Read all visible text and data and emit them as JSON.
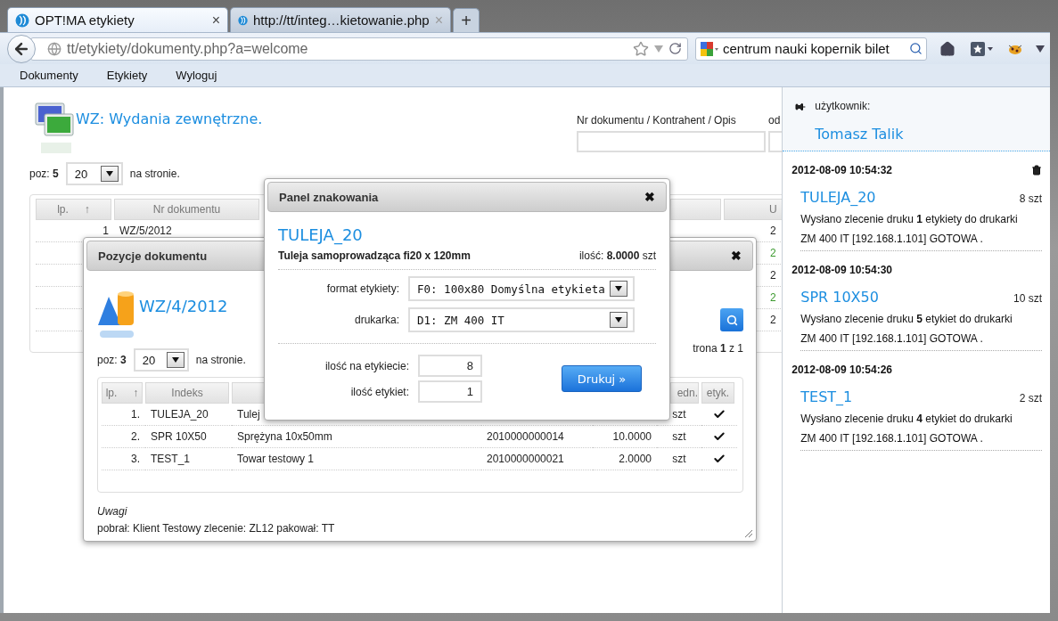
{
  "browser": {
    "tabs": [
      {
        "title": "OPT!MA etykiety",
        "close": "×",
        "selected": true
      },
      {
        "title": "http://tt/integ…kietowanie.php",
        "close": "×",
        "selected": false
      }
    ],
    "new_tab": "+",
    "address": "tt/etykiety/dokumenty.php?a=welcome",
    "search": {
      "value": "centrum nauki kopernik bilet"
    }
  },
  "menu": [
    "Dokumenty",
    "Etykiety",
    "Wyloguj"
  ],
  "page": {
    "title": "WZ: Wydania zewnętrzne.",
    "search_label": "Nr dokumentu / Kontrahent / Opis",
    "from_label": "od",
    "pager": {
      "prefix": "poz:",
      "count": "5",
      "page_size": "20",
      "suffix": "na stronie."
    },
    "table": {
      "header": {
        "lp": "lp.",
        "sort_mark": "↑",
        "number": "Nr dokumentu",
        "column_3": "U"
      },
      "rows": [
        {
          "lp": "1",
          "number": "WZ/5/2012",
          "column_3": "2",
          "color": "#222222"
        },
        {
          "column_3": "2",
          "color": "#3c9a2e"
        },
        {
          "column_3": "2",
          "color": "#222222"
        },
        {
          "column_3": "2",
          "color": "#3c9a2e"
        },
        {
          "column_3": "2",
          "color": "#222222"
        }
      ]
    }
  },
  "sidebar": {
    "user_label": "użytkownik:",
    "user_name": "Tomasz Talik",
    "entries": [
      {
        "time": "2012-08-09 10:54:32",
        "item": "TULEJA_20",
        "qty": "8 szt",
        "message": "Wysłano zlecenie druku **1** etykiety do drukarki ZM 400 IT [192.168.1.101] GOTOWA ."
      },
      {
        "time": "2012-08-09 10:54:30",
        "item": "SPR 10X50",
        "qty": "10 szt",
        "message": "Wysłano zlecenie druku **5** etykiet do drukarki ZM 400 IT [192.168.1.101] GOTOWA ."
      },
      {
        "time": "2012-08-09 10:54:26",
        "item": "TEST_1",
        "qty": "2 szt",
        "message": "Wysłano zlecenie druku **4** etykiet do drukarki ZM 400 IT [192.168.1.101] GOTOWA ."
      }
    ]
  },
  "positions_dialog": {
    "title": "Pozycje dokumentu",
    "close": "✖",
    "document": "WZ/4/2012",
    "pager": {
      "prefix": "poz:",
      "count": "3",
      "page_size": "20",
      "suffix": "na stronie."
    },
    "pages": "trona **1** z 1",
    "header": {
      "lp": "lp.",
      "sort_mark": "↑",
      "index": "Indeks",
      "unit": "edn.",
      "labeled": "etyk."
    },
    "rows": [
      {
        "lp": "1.",
        "index": "TULEJA_20",
        "name": "Tulej",
        "unit": "szt",
        "labeled": true
      },
      {
        "lp": "2.",
        "index": "SPR 10X50",
        "name": "Sprężyna 10x50mm",
        "code": "2010000000014",
        "qty": "10.0000",
        "unit": "szt",
        "labeled": true
      },
      {
        "lp": "3.",
        "index": "TEST_1",
        "name": "Towar testowy 1",
        "code": "2010000000021",
        "qty": "2.0000",
        "unit": "szt",
        "labeled": true
      }
    ],
    "notes_label": "Uwagi",
    "notes": "pobrał: Klient Testowy zlecenie: ZL12 pakował: TT"
  },
  "marking_panel": {
    "title": "Panel znakowania",
    "close": "✖",
    "item": "TULEJA_20",
    "description": "Tuleja samoprowadząca fi20 x 120mm",
    "quantity": "ilość: **8.0000** szt",
    "fields": [
      {
        "label": "format etykiety:",
        "value": "F0: 100x80 Domyślna etykieta",
        "kind": "select"
      },
      {
        "label": "drukarka:",
        "value": "D1: ZM 400 IT",
        "kind": "select"
      }
    ],
    "quantities": [
      {
        "label": "ilość na etykiecie:",
        "value": "8"
      },
      {
        "label": "ilość etykiet:",
        "value": "1"
      }
    ],
    "print_button": "Drukuj »"
  }
}
